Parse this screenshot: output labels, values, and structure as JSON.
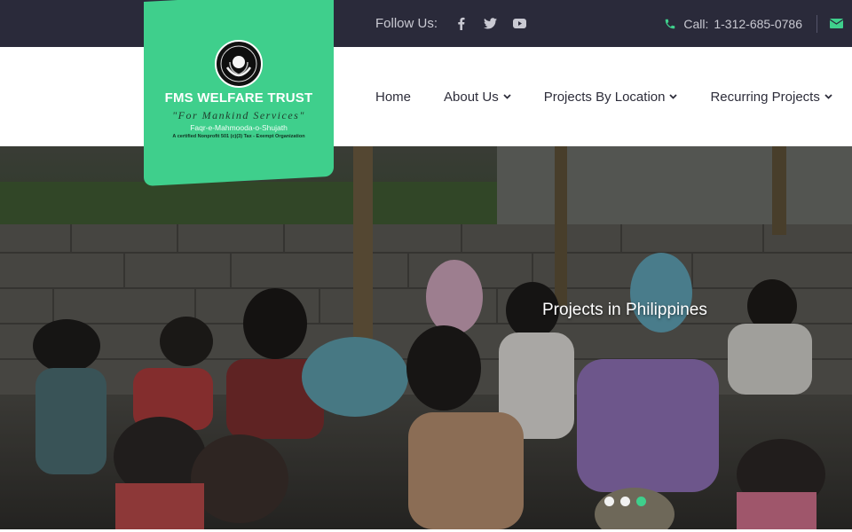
{
  "topbar": {
    "follow_label": "Follow Us:",
    "social_icons": [
      "facebook-icon",
      "twitter-icon",
      "youtube-icon"
    ],
    "call_label": "Call:",
    "phone": "1-312-685-0786",
    "mail_icon": "envelope-icon"
  },
  "logo": {
    "name": "FMS WELFARE TRUST",
    "tagline": "\"For Mankind Services\"",
    "subtitle": "Faqr-e-Mahmooda-o-Shujath",
    "certified": "A certified Nonprofit 501 (c)(3) Tax - Exempt Organization"
  },
  "nav": {
    "items": [
      {
        "label": "Home",
        "has_dropdown": false
      },
      {
        "label": "About Us",
        "has_dropdown": true
      },
      {
        "label": "Projects By Location",
        "has_dropdown": true
      },
      {
        "label": "Recurring Projects",
        "has_dropdown": true
      }
    ]
  },
  "hero": {
    "caption": "Projects in Philippines",
    "slides_total": 3,
    "active_slide": 3
  },
  "colors": {
    "accent": "#3fcf8c",
    "topbar_bg": "#2a2a3a",
    "nav_text": "#2d2d3a"
  }
}
